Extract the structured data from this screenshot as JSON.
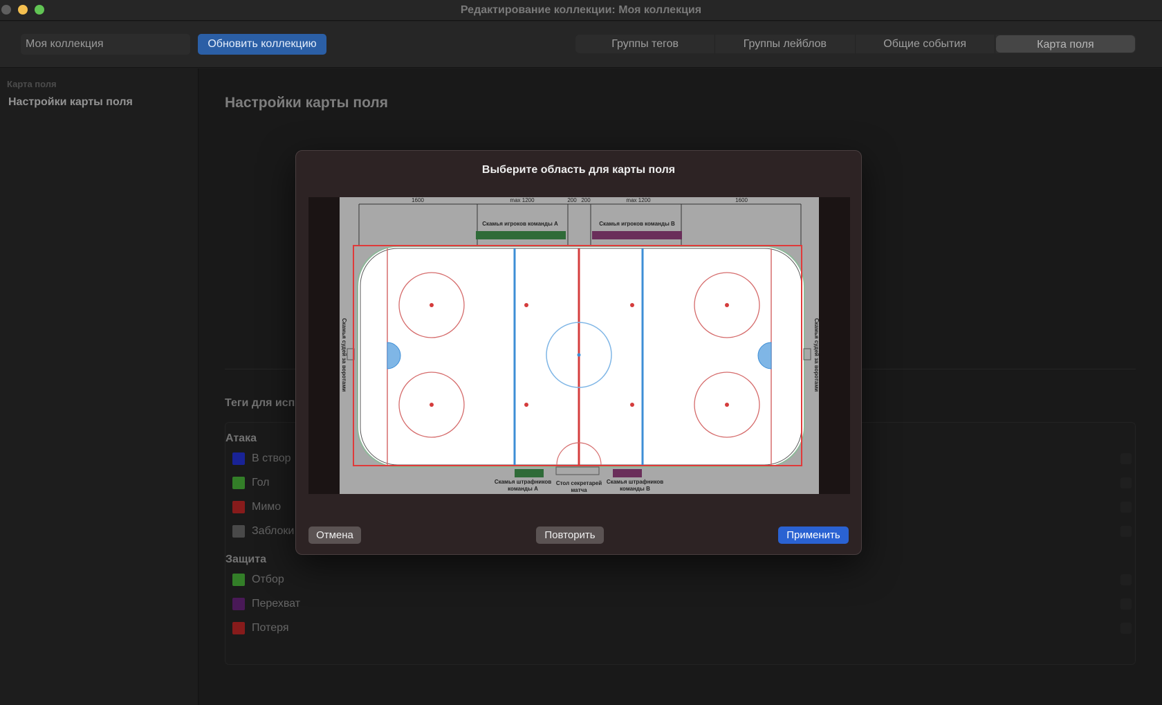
{
  "window": {
    "title": "Редактирование коллекции: Моя коллекция"
  },
  "toolbar": {
    "collection_name": "Моя коллекция",
    "refresh_label": "Обновить коллекцию",
    "tabs": [
      {
        "label": "Группы тегов"
      },
      {
        "label": "Группы лейблов"
      },
      {
        "label": "Общие события"
      },
      {
        "label": "Карта поля",
        "active": true
      }
    ]
  },
  "sidebar": {
    "section": "Карта поля",
    "items": [
      {
        "label": "Настройки карты поля"
      }
    ]
  },
  "main": {
    "title": "Настройки карты поля",
    "tags_title": "Теги для исп",
    "groups": [
      {
        "name": "Атака",
        "tags": [
          {
            "label": "В створ",
            "color": "#1f2bb8"
          },
          {
            "label": "Гол",
            "color": "#3f9a31"
          },
          {
            "label": "Мимо",
            "color": "#a52222"
          },
          {
            "label": "Заблоки",
            "color": "#5a5a5a"
          }
        ]
      },
      {
        "name": "Защита",
        "tags": [
          {
            "label": "Отбор",
            "color": "#3f9a31"
          },
          {
            "label": "Перехват",
            "color": "#5a1f6b"
          },
          {
            "label": "Потеря",
            "color": "#a52222"
          }
        ]
      }
    ]
  },
  "modal": {
    "title": "Выберите область для карты поля",
    "cancel_label": "Отмена",
    "repeat_label": "Повторить",
    "apply_label": "Применить",
    "rink": {
      "dims": [
        "1600",
        "max 1200",
        "200",
        "200",
        "max 1200",
        "1600"
      ],
      "bench_a": "Скамья игроков команды А",
      "bench_b": "Скамья игроков команды В",
      "penalty_a": [
        "Скамья штрафников",
        "команды А"
      ],
      "penalty_b": [
        "Скамья штрафников",
        "команды В"
      ],
      "secretary": [
        "Стол секретарей",
        "матча"
      ],
      "side_left": "Скамья судей за воротами",
      "side_right": "Скамья судей за воротами"
    }
  }
}
